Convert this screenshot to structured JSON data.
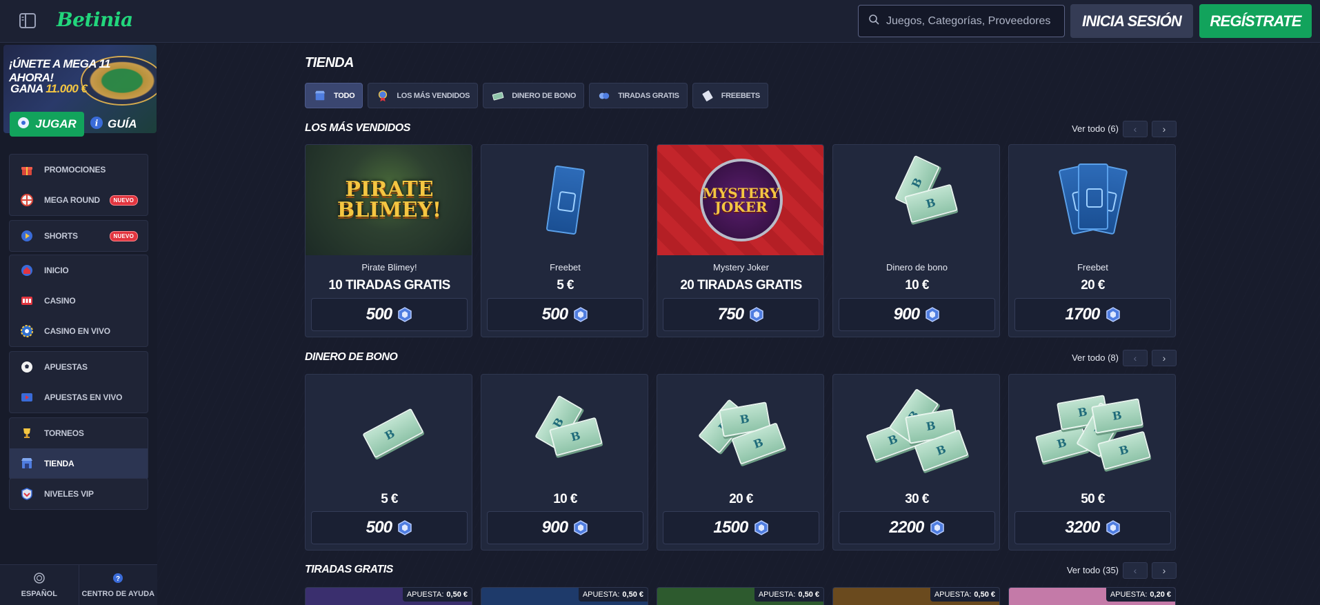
{
  "header": {
    "logo_text": "Betinia",
    "search_placeholder": "Juegos, Categorías, Proveedores",
    "login_label": "INICIA SESIÓN",
    "register_label": "REGÍSTRATE"
  },
  "promo": {
    "title": "¡ÚNETE A MEGA 11 AHORA!",
    "sub_prefix": "GANA",
    "sub_amount": "11.000 €",
    "play_label": "JUGAR",
    "guide_label": "GUÍA"
  },
  "sidebar": {
    "groups": [
      {
        "items": [
          {
            "label": "PROMOCIONES",
            "icon": "gift-icon"
          },
          {
            "label": "MEGA ROUND",
            "icon": "wheel-icon",
            "badge": "NUEVO"
          }
        ]
      },
      {
        "items": [
          {
            "label": "SHORTS",
            "icon": "play-icon",
            "badge": "NUEVO"
          }
        ]
      },
      {
        "items": [
          {
            "label": "INICIO",
            "icon": "home-icon"
          },
          {
            "label": "CASINO",
            "icon": "slot-icon"
          },
          {
            "label": "CASINO EN VIVO",
            "icon": "chip-icon"
          }
        ]
      },
      {
        "items": [
          {
            "label": "APUESTAS",
            "icon": "ball-icon"
          },
          {
            "label": "APUESTAS EN VIVO",
            "icon": "live-icon"
          }
        ]
      },
      {
        "items": [
          {
            "label": "TORNEOS",
            "icon": "trophy-icon"
          },
          {
            "label": "TIENDA",
            "icon": "shop-icon",
            "active": true
          }
        ]
      },
      {
        "items": [
          {
            "label": "NIVELES VIP",
            "icon": "vip-icon"
          }
        ]
      }
    ],
    "footer": {
      "language": "ESPAÑOL",
      "help": "CENTRO DE AYUDA"
    }
  },
  "page": {
    "title": "TIENDA",
    "filters": [
      {
        "label": "TODO",
        "active": true
      },
      {
        "label": "LOS MÁS VENDIDOS"
      },
      {
        "label": "DINERO DE BONO"
      },
      {
        "label": "TIRADAS GRATIS"
      },
      {
        "label": "FREEBETS"
      }
    ]
  },
  "sections": {
    "best_sellers": {
      "title": "LOS MÁS VENDIDOS",
      "more": "Ver todo (6)",
      "cards": [
        {
          "name": "Pirate Blimey!",
          "amount": "10 TIRADAS GRATIS",
          "price": "500",
          "art": "game-pirate",
          "art_text": "PIRATE BLIMEY!"
        },
        {
          "name": "Freebet",
          "amount": "5 €",
          "price": "500",
          "art": "ticket"
        },
        {
          "name": "Mystery Joker",
          "amount": "20 TIRADAS GRATIS",
          "price": "750",
          "art": "game-joker",
          "art_text": "MYSTERY JOKER"
        },
        {
          "name": "Dinero de bono",
          "amount": "10 €",
          "price": "900",
          "art": "cash"
        },
        {
          "name": "Freebet",
          "amount": "20 €",
          "price": "1700",
          "art": "tickets"
        }
      ]
    },
    "bonus_money": {
      "title": "DINERO DE BONO",
      "more": "Ver todo (8)",
      "cards": [
        {
          "amount": "5 €",
          "price": "500",
          "stacks": 1
        },
        {
          "amount": "10 €",
          "price": "900",
          "stacks": 2
        },
        {
          "amount": "20 €",
          "price": "1500",
          "stacks": 3
        },
        {
          "amount": "30 €",
          "price": "2200",
          "stacks": 4
        },
        {
          "amount": "50 €",
          "price": "3200",
          "stacks": 5
        }
      ]
    },
    "free_spins": {
      "title": "TIRADAS GRATIS",
      "more": "Ver todo (35)",
      "bet_label": "APUESTA:",
      "cards": [
        {
          "bet": "0,50 €",
          "color": "#3a2f6e"
        },
        {
          "bet": "0,50 €",
          "color": "#1e3a6a"
        },
        {
          "bet": "0,50 €",
          "color": "#2d5a2e"
        },
        {
          "bet": "0,50 €",
          "color": "#6a4a1e"
        },
        {
          "bet": "0,20 €",
          "color": "#c47aa8"
        }
      ]
    }
  }
}
